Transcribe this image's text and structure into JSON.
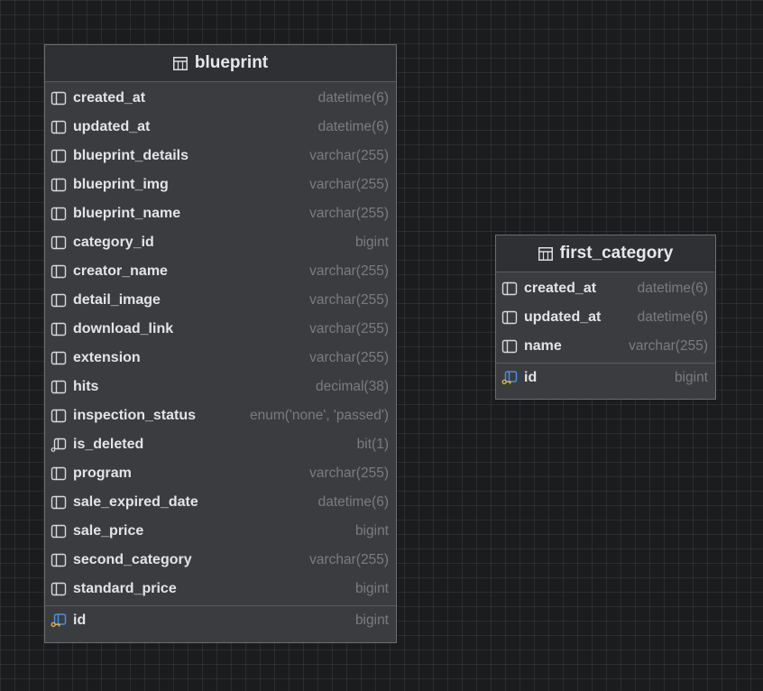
{
  "tables": [
    {
      "name": "blueprint",
      "columns": [
        {
          "name": "created_at",
          "type": "datetime(6)",
          "icon": "column-icon"
        },
        {
          "name": "updated_at",
          "type": "datetime(6)",
          "icon": "column-icon"
        },
        {
          "name": "blueprint_details",
          "type": "varchar(255)",
          "icon": "column-icon"
        },
        {
          "name": "blueprint_img",
          "type": "varchar(255)",
          "icon": "column-icon"
        },
        {
          "name": "blueprint_name",
          "type": "varchar(255)",
          "icon": "column-icon"
        },
        {
          "name": "category_id",
          "type": "bigint",
          "icon": "column-icon"
        },
        {
          "name": "creator_name",
          "type": "varchar(255)",
          "icon": "column-icon"
        },
        {
          "name": "detail_image",
          "type": "varchar(255)",
          "icon": "column-icon"
        },
        {
          "name": "download_link",
          "type": "varchar(255)",
          "icon": "column-icon"
        },
        {
          "name": "extension",
          "type": "varchar(255)",
          "icon": "column-icon"
        },
        {
          "name": "hits",
          "type": "decimal(38)",
          "icon": "column-icon"
        },
        {
          "name": "inspection_status",
          "type": "enum('none', 'passed')",
          "icon": "column-icon"
        },
        {
          "name": "is_deleted",
          "type": "bit(1)",
          "icon": "not-null-column-icon"
        },
        {
          "name": "program",
          "type": "varchar(255)",
          "icon": "column-icon"
        },
        {
          "name": "sale_expired_date",
          "type": "datetime(6)",
          "icon": "column-icon"
        },
        {
          "name": "sale_price",
          "type": "bigint",
          "icon": "column-icon"
        },
        {
          "name": "second_category",
          "type": "varchar(255)",
          "icon": "column-icon"
        },
        {
          "name": "standard_price",
          "type": "bigint",
          "icon": "column-icon"
        }
      ],
      "primary_key": {
        "name": "id",
        "type": "bigint",
        "icon": "primary-key-icon"
      }
    },
    {
      "name": "first_category",
      "columns": [
        {
          "name": "created_at",
          "type": "datetime(6)",
          "icon": "column-icon"
        },
        {
          "name": "updated_at",
          "type": "datetime(6)",
          "icon": "column-icon"
        },
        {
          "name": "name",
          "type": "varchar(255)",
          "icon": "column-icon"
        }
      ],
      "primary_key": {
        "name": "id",
        "type": "bigint",
        "icon": "primary-key-icon"
      }
    }
  ],
  "colors": {
    "canvas": "#1b1c1e",
    "table_body": "#3b3c3f",
    "table_header": "#2f3033",
    "border": "#6b6d71",
    "text": "#e3e4e6",
    "type_text": "#7a7c80",
    "pk_key": "#d9b24c",
    "pk_column": "#4a8fe0"
  }
}
